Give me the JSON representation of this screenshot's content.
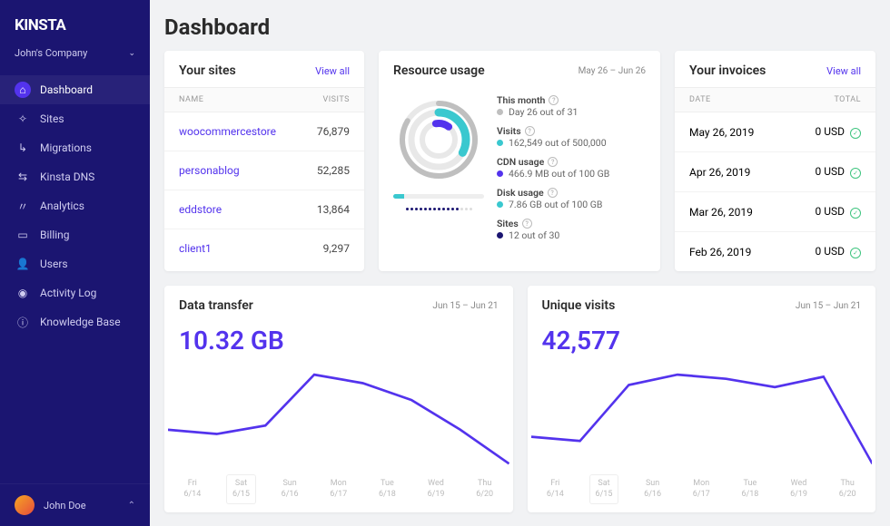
{
  "brand": "KINSTA",
  "company": "John's Company",
  "nav": [
    {
      "label": "Dashboard",
      "icon": "⌂"
    },
    {
      "label": "Sites",
      "icon": "✧"
    },
    {
      "label": "Migrations",
      "icon": "↳"
    },
    {
      "label": "Kinsta DNS",
      "icon": "⇆"
    },
    {
      "label": "Analytics",
      "icon": "〃"
    },
    {
      "label": "Billing",
      "icon": "▭"
    },
    {
      "label": "Users",
      "icon": "👤"
    },
    {
      "label": "Activity Log",
      "icon": "◉"
    },
    {
      "label": "Knowledge Base",
      "icon": "ⓘ"
    }
  ],
  "user": "John Doe",
  "page_title": "Dashboard",
  "sites_card": {
    "title": "Your sites",
    "viewall": "View all",
    "col_name": "NAME",
    "col_visits": "VISITS",
    "rows": [
      {
        "name": "woocommercestore",
        "visits": "76,879"
      },
      {
        "name": "personablog",
        "visits": "52,285"
      },
      {
        "name": "eddstore",
        "visits": "13,864"
      },
      {
        "name": "client1",
        "visits": "9,297"
      }
    ]
  },
  "resource_card": {
    "title": "Resource usage",
    "range": "May 26 – Jun 26",
    "metrics": {
      "month_title": "This month",
      "month_val": "Day 26 out of 31",
      "visits_title": "Visits",
      "visits_val": "162,549 out of 500,000",
      "cdn_title": "CDN usage",
      "cdn_val": "466.9 MB out of 100 GB",
      "disk_title": "Disk usage",
      "disk_val": "7.86 GB out of 100 GB",
      "sites_title": "Sites",
      "sites_val": "12 out of 30"
    }
  },
  "invoices_card": {
    "title": "Your invoices",
    "viewall": "View all",
    "col_date": "DATE",
    "col_total": "TOTAL",
    "rows": [
      {
        "date": "May 26, 2019",
        "total": "0 USD"
      },
      {
        "date": "Apr 26, 2019",
        "total": "0 USD"
      },
      {
        "date": "Mar 26, 2019",
        "total": "0 USD"
      },
      {
        "date": "Feb 26, 2019",
        "total": "0 USD"
      }
    ]
  },
  "transfer_card": {
    "title": "Data transfer",
    "range": "Jun 15 – Jun 21",
    "value": "10.32 GB"
  },
  "visits_card": {
    "title": "Unique visits",
    "range": "Jun 15 – Jun 21",
    "value": "42,577"
  },
  "ticks": [
    {
      "d": "Fri",
      "n": "6/14"
    },
    {
      "d": "Sat",
      "n": "6/15"
    },
    {
      "d": "Sun",
      "n": "6/16"
    },
    {
      "d": "Mon",
      "n": "6/17"
    },
    {
      "d": "Tue",
      "n": "6/18"
    },
    {
      "d": "Wed",
      "n": "6/19"
    },
    {
      "d": "Thu",
      "n": "6/20"
    }
  ],
  "chart_data": [
    {
      "type": "line",
      "title": "Data transfer",
      "series": [
        {
          "name": "GB",
          "values": [
            1.0,
            0.9,
            1.1,
            2.3,
            2.1,
            1.7,
            1.0,
            0.2
          ]
        }
      ],
      "x": [
        "6/14",
        "6/15",
        "6/16",
        "6/17",
        "6/18",
        "6/19",
        "6/20",
        "6/21"
      ],
      "total": "10.32 GB"
    },
    {
      "type": "line",
      "title": "Unique visits",
      "series": [
        {
          "name": "visits",
          "values": [
            3800,
            3600,
            6300,
            6800,
            6600,
            6200,
            6700,
            2500
          ]
        }
      ],
      "x": [
        "6/14",
        "6/15",
        "6/16",
        "6/17",
        "6/18",
        "6/19",
        "6/20",
        "6/21"
      ],
      "total": "42,577"
    }
  ]
}
